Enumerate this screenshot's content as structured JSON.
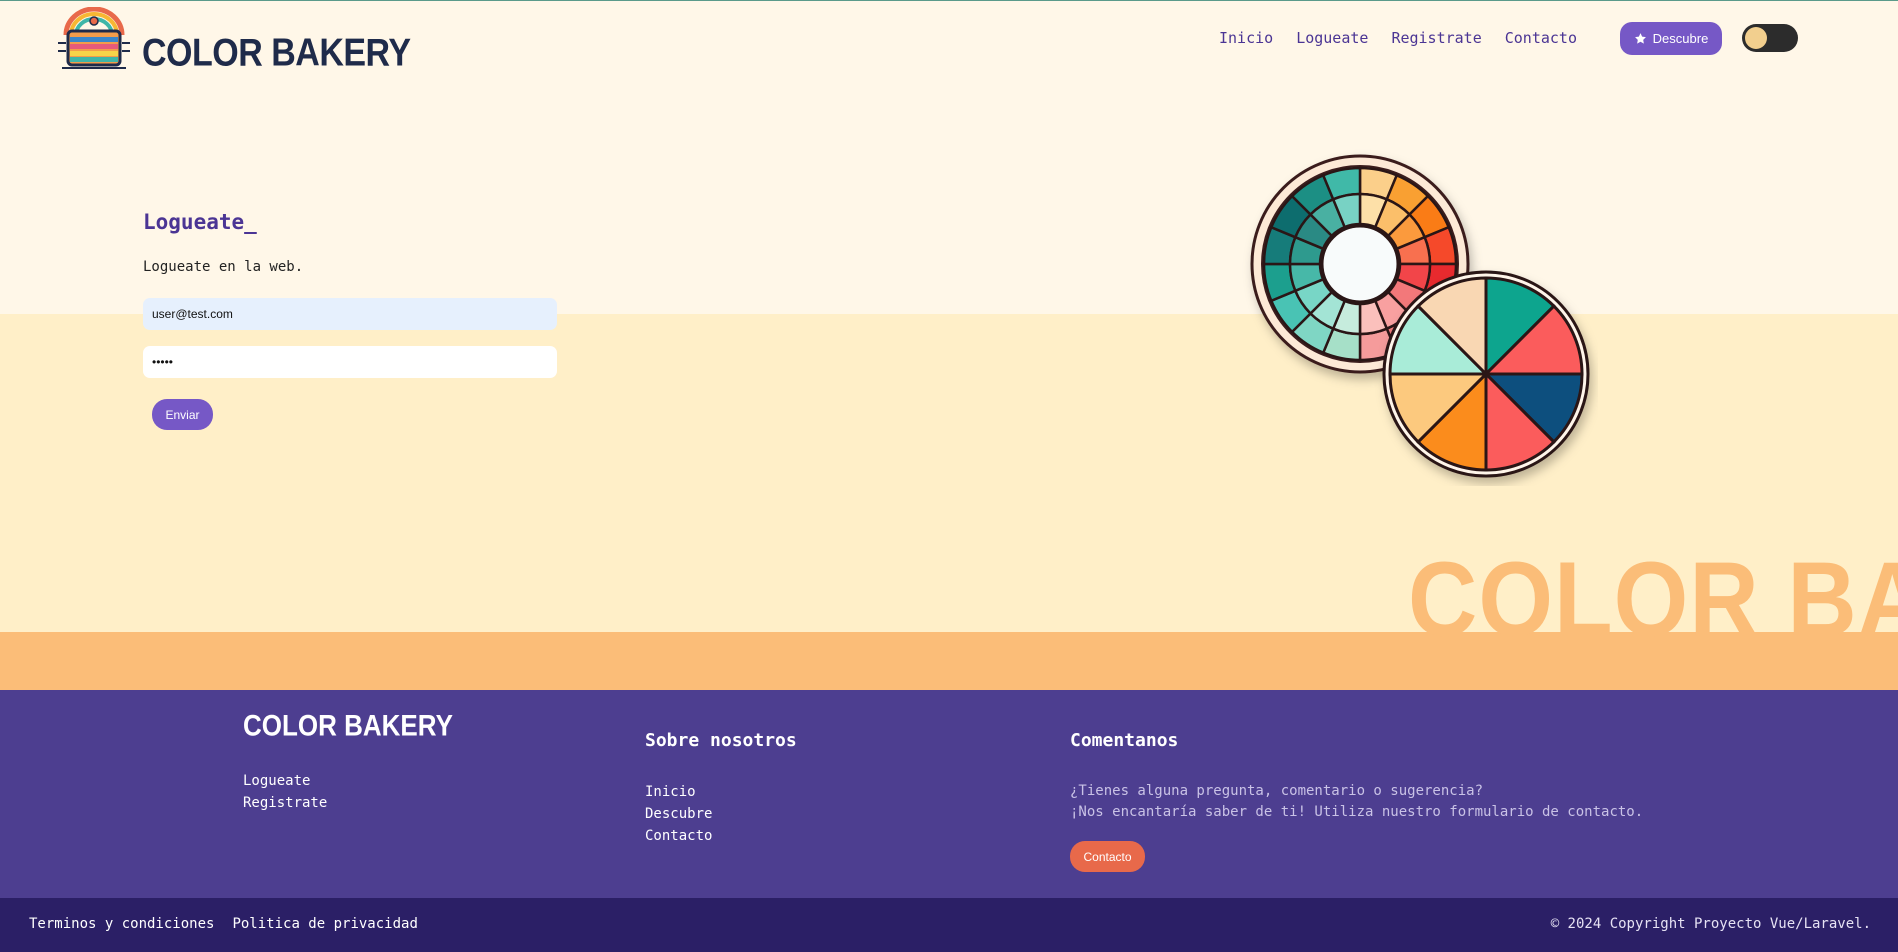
{
  "header": {
    "brand": "COLOR BAKERY",
    "nav": [
      "Inicio",
      "Logueate",
      "Registrate",
      "Contacto"
    ],
    "discover_button": "Descubre",
    "theme_toggle_icon": "toggle-switch"
  },
  "login": {
    "title": "Logueate_",
    "subtitle": "Logueate en la web.",
    "email_value": "user@test.com",
    "password_value": "•••••",
    "submit_label": "Enviar"
  },
  "hero": {
    "brand_watermark": "COLOR BAKERY",
    "illustration_icon": "color-wheel-illustration"
  },
  "footer": {
    "brand": "COLOR BAKERY",
    "account_links": [
      "Logueate",
      "Registrate"
    ],
    "about_title": "Sobre nosotros",
    "about_links": [
      "Inicio",
      "Descubre",
      "Contacto"
    ],
    "comment_title": "Comentanos",
    "comment_line1": "¿Tienes alguna pregunta, comentario o sugerencia?",
    "comment_line2": "¡Nos encantaría saber de ti! Utiliza nuestro formulario de contacto.",
    "contact_button": "Contacto"
  },
  "bottom_bar": {
    "terms": "Terminos y condiciones",
    "privacy": "Politica de privacidad",
    "copyright": "© 2024 Copyright Proyecto Vue/Laravel."
  },
  "colors": {
    "background": "#fff7e8",
    "band_light": "#ffefc8",
    "band_orange": "#fbbd78",
    "accent": "#7658c6",
    "nav_text": "#4b3594",
    "footer": "#4d3e90",
    "bottom_bar": "#2b1f66",
    "contact_button": "#e8694a"
  }
}
